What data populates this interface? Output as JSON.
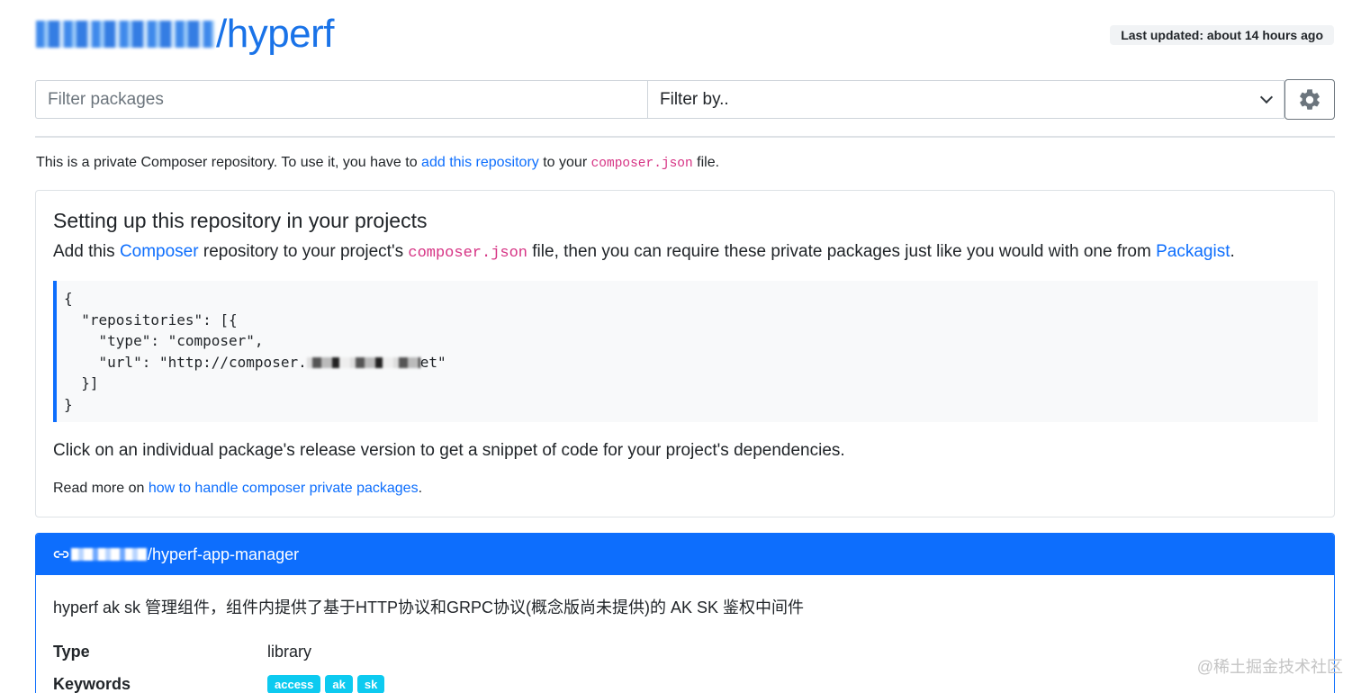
{
  "header": {
    "brand_suffix": "/hyperf",
    "last_updated": "Last updated: about 14 hours ago"
  },
  "filter": {
    "search_placeholder": "Filter packages",
    "filter_by_label": "Filter by..",
    "settings_icon": "gear-icon"
  },
  "intro": {
    "text_before": "This is a private Composer repository. To use it, you have to ",
    "link": "add this repository",
    "text_middle": " to your ",
    "code": "composer.json",
    "text_after": " file."
  },
  "setup": {
    "title": "Setting up this repository in your projects",
    "desc_before": "Add this ",
    "composer_link": "Composer",
    "desc_middle": " repository to your project's ",
    "desc_code": "composer.json",
    "desc_middle2": " file, then you can require these private packages just like you would with one from ",
    "packagist_link": "Packagist",
    "desc_end": ".",
    "code_lines": {
      "l1": "{",
      "l2": "  \"repositories\": [{",
      "l3": "    \"type\": \"composer\",",
      "l4_prefix": "    \"url\": \"http://composer.",
      "l4_suffix": "et\"",
      "l5": "  }]",
      "l6": "}"
    },
    "click_text": "Click on an individual package's release version to get a snippet of code for your project's dependencies.",
    "read_more_prefix": "Read more on ",
    "read_more_link": "how to handle composer private packages",
    "read_more_suffix": "."
  },
  "package": {
    "link_icon": "link-icon",
    "name_suffix": "/hyperf-app-manager",
    "description": "hyperf ak sk 管理组件，组件内提供了基于HTTP协议和GRPC协议(概念版尚未提供)的 AK SK 鉴权中间件",
    "type_label": "Type",
    "type_value": "library",
    "keywords_label": "Keywords",
    "keywords": [
      "access",
      "ak",
      "sk"
    ]
  },
  "watermark": "@稀土掘金技术社区",
  "colors": {
    "primary": "#0d6efd",
    "brand": "#1a73e8",
    "code_pink": "#d63384",
    "tag_cyan": "#0dcaf0"
  }
}
